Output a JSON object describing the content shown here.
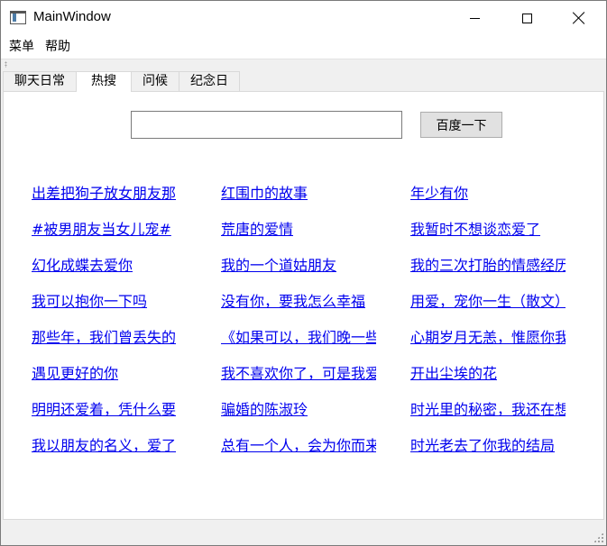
{
  "window": {
    "title": "MainWindow",
    "icons": {
      "app": "window-app-icon",
      "minimize": "minimize-icon",
      "maximize": "maximize-icon",
      "close": "close-icon"
    }
  },
  "menubar": {
    "items": [
      "菜单",
      "帮助"
    ]
  },
  "tabs": [
    {
      "label": "聊天日常",
      "active": false
    },
    {
      "label": "热搜",
      "active": true
    },
    {
      "label": "问候",
      "active": false
    },
    {
      "label": "纪念日",
      "active": false
    }
  ],
  "search": {
    "value": "",
    "placeholder": "",
    "button_label": "百度一下"
  },
  "links": {
    "col1": [
      "出差把狗子放女朋友那",
      "#被男朋友当女儿宠#",
      "幻化成蝶去爱你",
      "我可以抱你一下吗",
      "那些年，我们曾丢失的",
      "遇见更好的你",
      "明明还爱着，凭什么要",
      "我以朋友的名义，爱了"
    ],
    "col2": [
      "红围巾的故事",
      "荒唐的爱情",
      "我的一个道姑朋友",
      "没有你，要我怎么幸福",
      "《如果可以，我们晚一些",
      "我不喜欢你了，可是我爱",
      "骗婚的陈淑玲",
      "总有一个人，会为你而来"
    ],
    "col3": [
      "年少有你",
      "我暂时不想谈恋爱了",
      "我的三次打胎的情感经历",
      "用爱，宠你一生（散文）",
      "心期岁月无恙，惟愿你我情",
      "开出尘埃的花",
      "时光里的秘密，我还在想你",
      "时光老去了你我的结局"
    ]
  },
  "colors": {
    "link": "#0000ee",
    "chrome": "#f0f0f0",
    "pane": "#ffffff"
  }
}
